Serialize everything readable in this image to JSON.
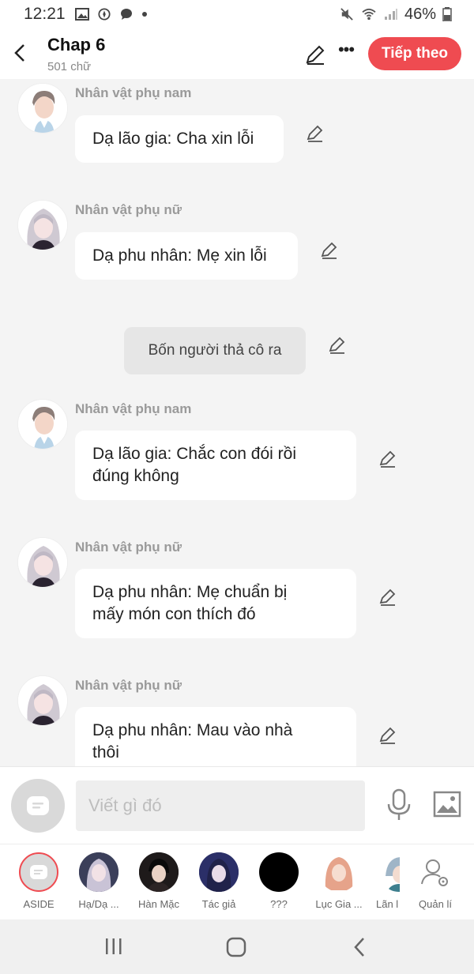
{
  "status": {
    "time": "12:21",
    "battery": "46%"
  },
  "header": {
    "title": "Chap 6",
    "subtitle": "501 chữ",
    "next_label": "Tiếp theo"
  },
  "messages": [
    {
      "speaker": "Nhân vật phụ nam",
      "text": "Dạ lão gia: Cha xin lỗi",
      "avatar": "male-avatar"
    },
    {
      "speaker": "Nhân vật phụ nữ",
      "text": "Dạ phu nhân: Mẹ xin lỗi",
      "avatar": "female-avatar"
    },
    {
      "narration": "Bốn người thả cô ra"
    },
    {
      "speaker": "Nhân vật phụ nam",
      "text_lines": [
        "Dạ lão gia: Chắc con đói rồi",
        "đúng không"
      ],
      "avatar": "male-avatar"
    },
    {
      "speaker": "Nhân vật phụ nữ",
      "text_lines": [
        "Dạ phu nhân: Mẹ chuẩn bị",
        "mấy món con thích đó"
      ],
      "avatar": "female-avatar"
    },
    {
      "speaker": "Nhân vật phụ nữ",
      "text_lines": [
        "Dạ phu nhân: Mau vào nhà",
        "thôi"
      ],
      "avatar": "female-avatar"
    }
  ],
  "input": {
    "placeholder": "Viết gì đó"
  },
  "characters": [
    {
      "name": "ASIDE",
      "color": "#d9d9d9"
    },
    {
      "name": "Hạ/Dạ ...",
      "color": "#3b3f5a"
    },
    {
      "name": "Hàn Mặc",
      "color": "#1e1a1a"
    },
    {
      "name": "Tác giả",
      "color": "#2b2f68"
    },
    {
      "name": "???",
      "color": "#000000"
    },
    {
      "name": "Lục Gia ...",
      "color": "#e6a38a"
    },
    {
      "name": "Lãn l",
      "color": "#9fb5c7"
    },
    {
      "name": "Quản lí",
      "color": "#ffffff"
    }
  ],
  "accent_color": "#ef4b51"
}
